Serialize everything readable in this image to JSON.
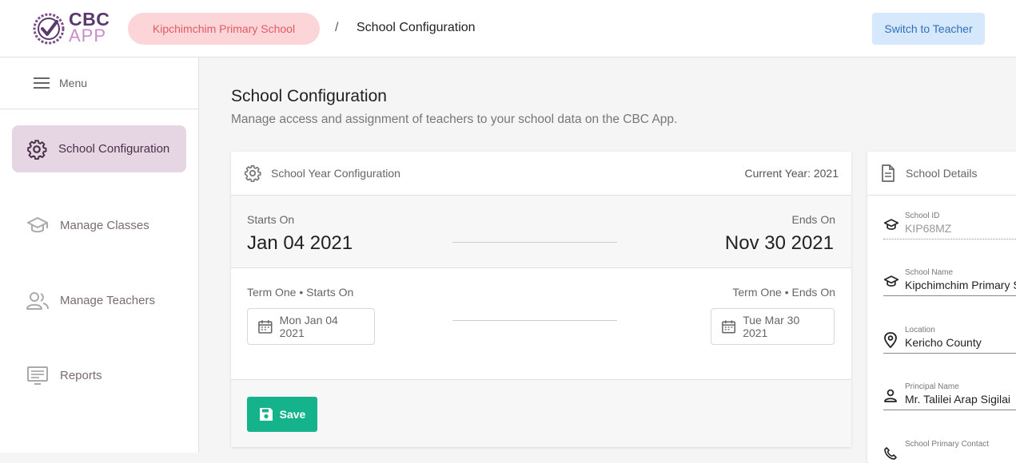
{
  "header": {
    "logo_top": "CBC",
    "logo_bottom": "APP",
    "school_name": "Kipchimchim Primary School",
    "breadcrumb_sep": "/",
    "breadcrumb_title": "School Configuration",
    "switch_button": "Switch to Teacher"
  },
  "sidebar": {
    "menu_label": "Menu",
    "items": [
      {
        "label": "School Configuration",
        "icon": "gear-icon",
        "active": true
      },
      {
        "label": "Manage Classes",
        "icon": "graduation-cap-icon"
      },
      {
        "label": "Manage Teachers",
        "icon": "people-icon"
      },
      {
        "label": "Reports",
        "icon": "monitor-icon"
      }
    ]
  },
  "main": {
    "title": "School Configuration",
    "subtitle": "Manage access and assignment of teachers to your school data on the CBC App."
  },
  "year_card": {
    "title": "School Year Configuration",
    "current_year": "Current Year: 2021",
    "starts_label": "Starts On",
    "starts_value": "Jan 04 2021",
    "ends_label": "Ends On",
    "ends_value": "Nov 30 2021",
    "term_starts_label": "Term One • Starts On",
    "term_starts_value": "Mon Jan 04 2021",
    "term_ends_label": "Term One • Ends On",
    "term_ends_value": "Tue Mar 30 2021",
    "save_label": "Save"
  },
  "details_card": {
    "title": "School Details",
    "fields": [
      {
        "label": "School ID",
        "value": "KIP68MZ"
      },
      {
        "label": "School Name",
        "value": "Kipchimchim Primary S"
      },
      {
        "label": "Location",
        "value": "Kericho County"
      },
      {
        "label": "Principal Name",
        "value": "Mr. Talilei Arap Sigilai"
      },
      {
        "label": "School Primary Contact",
        "value": ""
      }
    ]
  },
  "colors": {
    "accent": "#5a3a6e",
    "school_pill_bg": "#fbd5d8",
    "switch_bg": "#d6e8fb",
    "save_bg": "#14b38c",
    "active_nav_bg": "#e6d6e4"
  }
}
